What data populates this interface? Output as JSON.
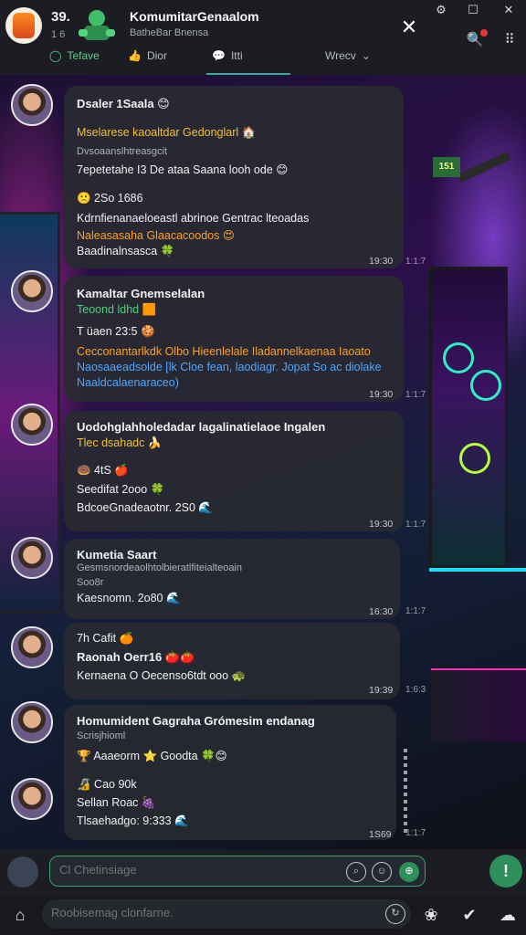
{
  "header": {
    "count": "39.",
    "count_sub": "1 6",
    "title": "KomumitarGenaalom",
    "subtitle": "BatheBar Bnensa",
    "close_icon": "close-icon",
    "tabs": [
      {
        "label": "Tefave",
        "icon": "circle-icon"
      },
      {
        "label": "Dior",
        "icon": "thumb-icon"
      },
      {
        "label": "Itti",
        "icon": "chat-icon"
      },
      {
        "label": "Wrecv",
        "icon": "chevron-down-icon"
      }
    ]
  },
  "colors": {
    "accent": "#3aa66e",
    "highlight_yellow": "#f2c037",
    "highlight_green": "#4cd07d",
    "link_blue": "#4ea7ff"
  },
  "posts": [
    {
      "lines": [
        "Dsaler 1Saala 😊",
        "Mselarese kaoaltdar Gedonglarl 🏠",
        "Dvsoaanslhtreasgcit",
        "7epetetahe I3 De ataa Saana looh ode 😊",
        "🙁 2So 1686",
        "Kdrnfienanaeloeastl abrinoe Gentrac lteoadas",
        "Naleasasaha Glaacacoodos 😍",
        "Baadinalnsasca 🍀"
      ],
      "time": "19:30",
      "count": "1:1:7"
    },
    {
      "lines": [
        "Kamaltar Gnemselalan",
        "Teoond ldhd 🟧",
        "T üaen 23:5 🍪",
        "Cecconantarlkdk Olbo Hieenlelale Iladannelkaenaa Iaoato",
        "Naosaaeadsolde [lk Cloe fean, laodiagr. Jopat So ac diolake",
        "Naaldcalaenaraceo)"
      ],
      "time": "19:30",
      "count": "1:1:7"
    },
    {
      "lines": [
        "Uodohglahholedadar lagalinatielaoe Ingalen",
        "Tlec dsahadc 🍌",
        "🍩 4tS 🍎",
        "Seedifat 2ooo 🍀",
        "BdcoeGnadeaotnr. 2S0 🌊"
      ],
      "time": "19:30",
      "count": "1:1:7"
    },
    {
      "lines": [
        "Kumetia Saart",
        "Gesmsnordeaolhtolbieratlfiteialteoain",
        "Soo8r",
        "Kaesnomn. 2o80 🌊"
      ],
      "time": "16:30",
      "count": "1:1:7"
    },
    {
      "lines": [
        "7h Cafit 🍊",
        "Raonah Oerr16 🍅🍅",
        "Kernaena O Oecenso6tdt ooo 🐢"
      ],
      "time": "19:39",
      "count": "1:6:3"
    },
    {
      "lines": [
        "Homumident Gagraha Grómesim endanag",
        "Scrisjhioml",
        "🏆 Aaaeorm ⭐ Goodta 🍀😊",
        "🔏 Cao 90k",
        "Sellan Roac 🍇",
        "Tlsaehadgo: 9:333 🌊"
      ],
      "time": "1S69",
      "count": "1:1:7"
    }
  ],
  "composer": {
    "placeholder": "Cl Chetinsiage"
  },
  "bottom": {
    "search_placeholder": "Roobisemag clonfarne."
  }
}
